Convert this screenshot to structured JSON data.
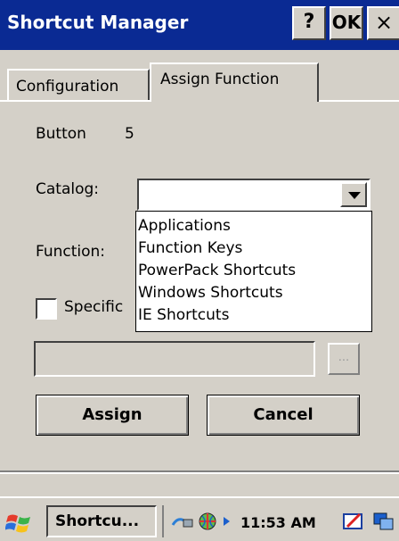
{
  "window": {
    "title": "Shortcut Manager",
    "help_label": "?",
    "ok_label": "OK",
    "close_label": "×"
  },
  "tabs": [
    {
      "label": "Configuration",
      "active": false
    },
    {
      "label": "Assign Function",
      "active": true
    }
  ],
  "form": {
    "button_label": "Button",
    "button_number": "5",
    "catalog_label": "Catalog:",
    "catalog_value": "",
    "function_label": "Function:",
    "catalog_options": [
      "Applications",
      "Function Keys",
      "PowerPack Shortcuts",
      "Windows Shortcuts",
      "IE Shortcuts"
    ],
    "specific_checkbox_label": "Specific",
    "specific_checked": false,
    "path_value": "",
    "browse_label": "...",
    "assign_label": "Assign",
    "cancel_label": "Cancel"
  },
  "taskbar": {
    "start_icon": "windows-flag-icon",
    "task_label": "Shortcu...",
    "clock": "11:53 AM",
    "tray_icons": [
      "network-icon",
      "globe-icon",
      "arrow-icon",
      "pen-icon",
      "windows-icon"
    ]
  },
  "colors": {
    "titlebar": "#0a2a93",
    "face": "#d4d0c8"
  }
}
